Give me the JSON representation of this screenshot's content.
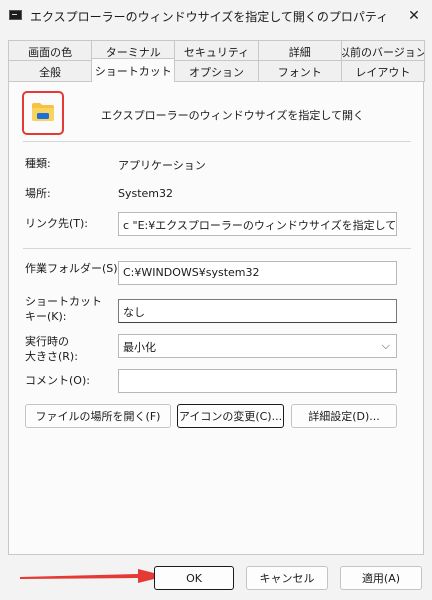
{
  "window": {
    "title": "エクスプローラーのウィンドウサイズを指定して開くのプロパティ",
    "close": "✕"
  },
  "tabs_row1": [
    "画面の色",
    "ターミナル",
    "セキュリティ",
    "詳細",
    "以前のバージョン"
  ],
  "tabs_row2": [
    "全般",
    "ショートカット",
    "オプション",
    "フォント",
    "レイアウト"
  ],
  "active_tab": "ショートカット",
  "shortcut": {
    "name": "エクスプローラーのウィンドウサイズを指定して開く",
    "type_label": "種類:",
    "type_value": "アプリケーション",
    "location_label": "場所:",
    "location_value": "System32",
    "target_label": "リンク先(T):",
    "target_value": "c \"E:¥エクスプローラーのウィンドウサイズを指定して開く.bat\"",
    "workdir_label": "作業フォルダー(S):",
    "workdir_value": "C:¥WINDOWS¥system32",
    "hotkey_label_1": "ショートカット",
    "hotkey_label_2": "キー(K):",
    "hotkey_value": "なし",
    "run_label_1": "実行時の",
    "run_label_2": "大きさ(R):",
    "run_value": "最小化",
    "comment_label": "コメント(O):",
    "comment_value": ""
  },
  "panel_buttons": {
    "open_location": "ファイルの場所を開く(F)",
    "change_icon": "アイコンの変更(C)...",
    "advanced": "詳細設定(D)..."
  },
  "footer_buttons": {
    "ok": "OK",
    "cancel": "キャンセル",
    "apply": "適用(A)"
  },
  "colors": {
    "highlight": "#e53935",
    "arrow": "#e53935",
    "folder": "#f5c242",
    "folder_badge": "#1e6fd9"
  }
}
